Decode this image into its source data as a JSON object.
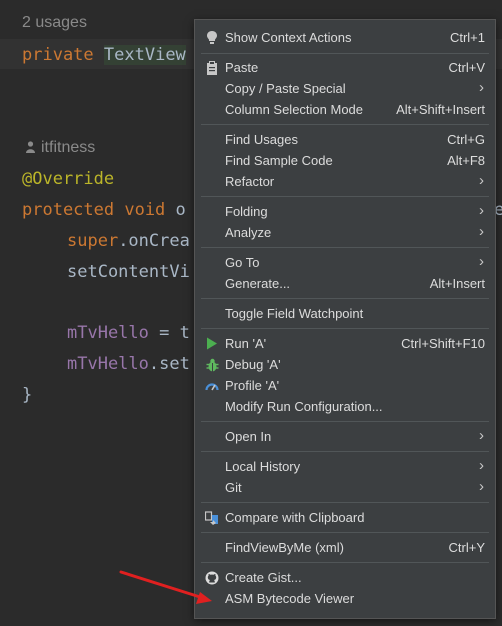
{
  "editor": {
    "usages": "2 usages",
    "line1": {
      "kw": "private",
      "type": "TextView"
    },
    "author": "itfitness",
    "annotation": "@Override",
    "method_line": {
      "kw": "protected void",
      "rest": "o"
    },
    "super_line": {
      "kw": "super",
      "rest": ".onCrea"
    },
    "setcontent_line": "setContentVi",
    "mtv_line1": {
      "field": "mTvHello",
      "rest": " = t"
    },
    "mtv_line2": {
      "field": "mTvHello",
      "rest": ".set"
    },
    "closing_brace": "}",
    "right_edge_char": "e"
  },
  "menu": {
    "items": [
      {
        "label": "Show Context Actions",
        "shortcut": "Ctrl+1",
        "icon": "lightbulb-icon"
      },
      {
        "label": "Paste",
        "shortcut": "Ctrl+V",
        "icon": "clipboard-icon"
      },
      {
        "label": "Copy / Paste Special",
        "submenu": true
      },
      {
        "label": "Column Selection Mode",
        "shortcut": "Alt+Shift+Insert"
      },
      {
        "label": "Find Usages",
        "shortcut": "Ctrl+G"
      },
      {
        "label": "Find Sample Code",
        "shortcut": "Alt+F8"
      },
      {
        "label": "Refactor",
        "submenu": true
      },
      {
        "label": "Folding",
        "submenu": true
      },
      {
        "label": "Analyze",
        "submenu": true
      },
      {
        "label": "Go To",
        "submenu": true
      },
      {
        "label": "Generate...",
        "shortcut": "Alt+Insert"
      },
      {
        "label": "Toggle Field Watchpoint"
      },
      {
        "label": "Run 'A'",
        "shortcut": "Ctrl+Shift+F10",
        "icon": "run-icon"
      },
      {
        "label": "Debug 'A'",
        "icon": "debug-icon"
      },
      {
        "label": "Profile 'A'",
        "icon": "profile-icon"
      },
      {
        "label": "Modify Run Configuration..."
      },
      {
        "label": "Open In",
        "submenu": true
      },
      {
        "label": "Local History",
        "submenu": true
      },
      {
        "label": "Git",
        "submenu": true
      },
      {
        "label": "Compare with Clipboard",
        "icon": "compare-icon"
      },
      {
        "label": "FindViewByMe (xml)",
        "shortcut": "Ctrl+Y"
      },
      {
        "label": "Create Gist...",
        "icon": "github-icon"
      },
      {
        "label": "ASM Bytecode Viewer"
      }
    ]
  },
  "colors": {
    "background": "#2b2b2b",
    "menu_bg": "#3c3f41",
    "keyword": "#cc7832",
    "annotation": "#bbb529",
    "field": "#9876aa",
    "annotation_arrow": "#e02020"
  }
}
